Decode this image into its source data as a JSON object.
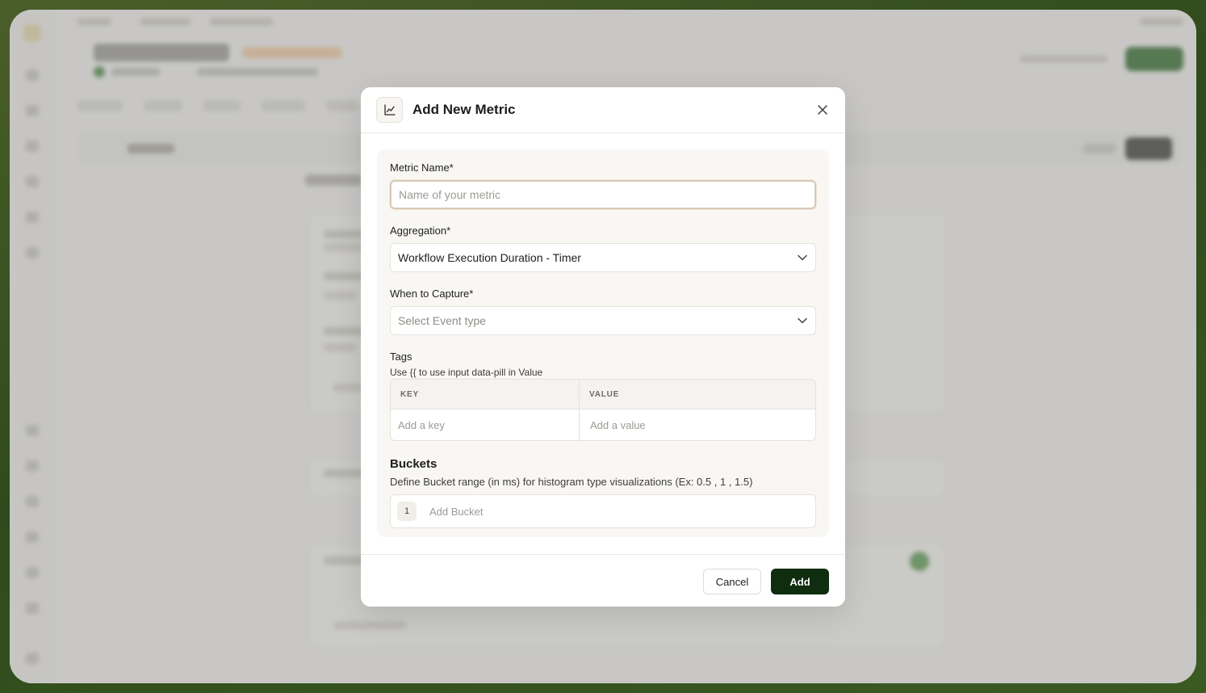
{
  "modal": {
    "title": "Add New Metric",
    "header_icon": "line-chart-icon",
    "close_icon": "close-icon",
    "metric_name": {
      "label": "Metric Name*",
      "value": "",
      "placeholder": "Name of your metric"
    },
    "aggregation": {
      "label": "Aggregation*",
      "selected": "Workflow Execution Duration - Timer"
    },
    "when_to_capture": {
      "label": "When to Capture*",
      "placeholder": "Select Event type"
    },
    "tags": {
      "label": "Tags",
      "hint": "Use {{ to use input data-pill in Value",
      "columns": [
        "KEY",
        "VALUE"
      ],
      "key_placeholder": "Add a key",
      "value_placeholder": "Add a value"
    },
    "buckets": {
      "title": "Buckets",
      "description": "Define Bucket range (in ms) for histogram type visualizations (Ex: 0.5 , 1 , 1.5)",
      "rows": [
        {
          "index": "1",
          "placeholder": "Add Bucket"
        }
      ]
    },
    "footer": {
      "cancel_label": "Cancel",
      "add_label": "Add"
    }
  },
  "colors": {
    "primary_button": "#0f2e10",
    "focus_border": "#d8c9b6",
    "backdrop": "#3b5a22"
  }
}
